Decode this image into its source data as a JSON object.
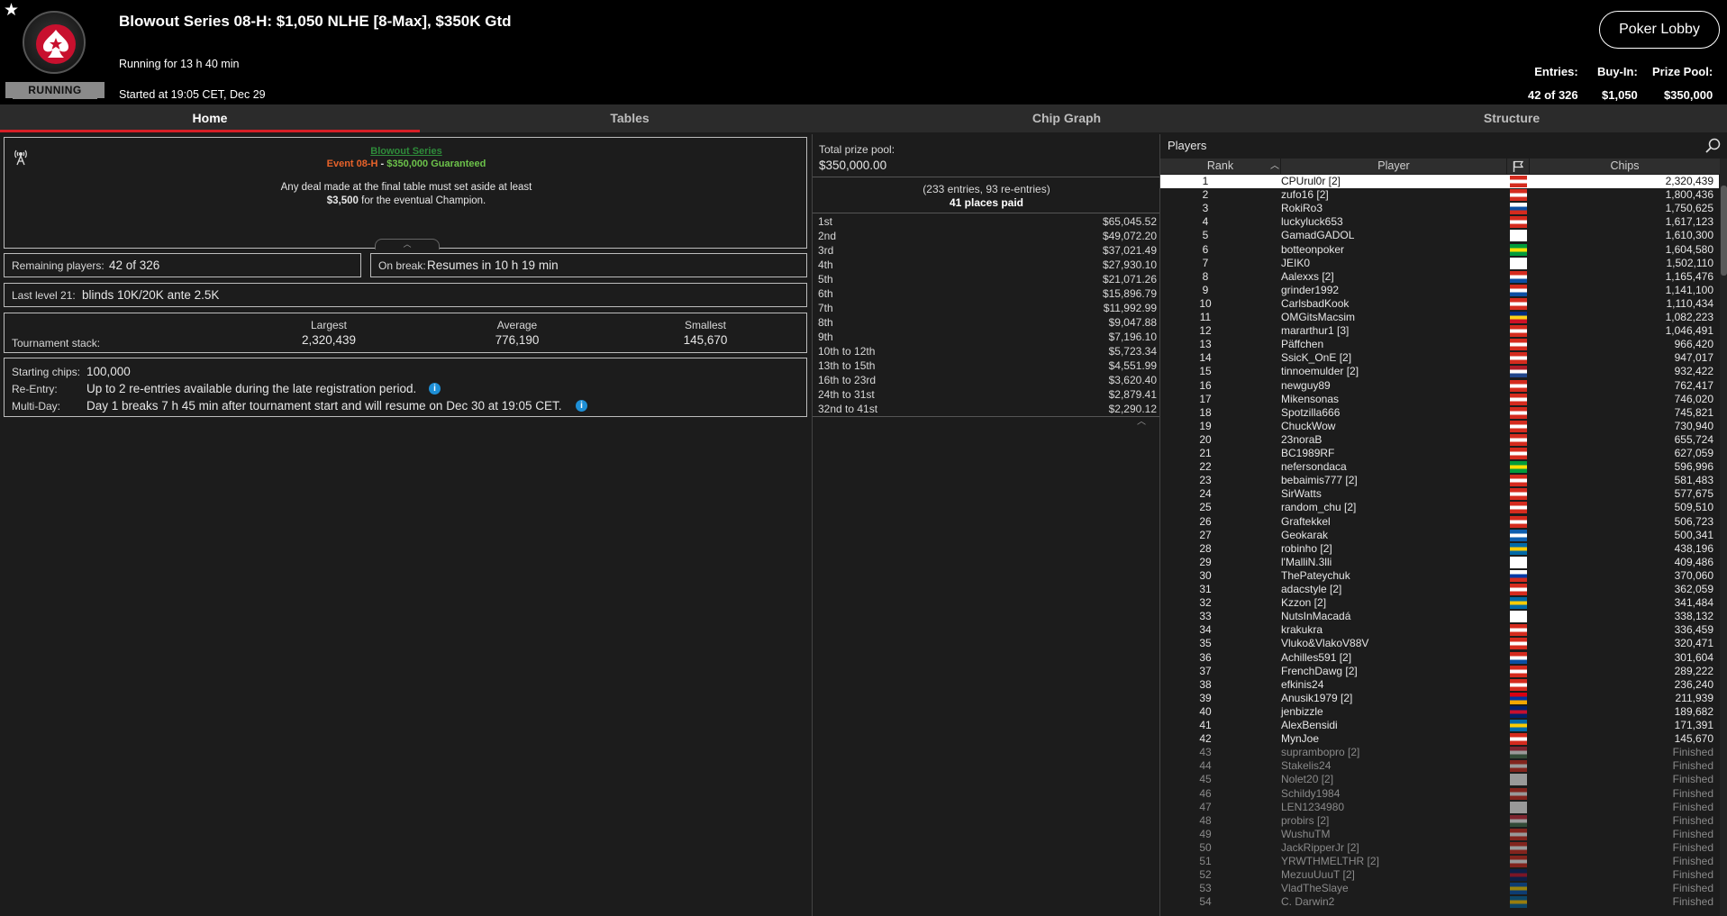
{
  "header": {
    "title": "Blowout Series 08-H: $1,050 NLHE [8-Max], $350K Gtd",
    "running_for": "Running for 13 h 40 min",
    "started": "Started at 19:05 CET, Dec 29",
    "status_badge": "RUNNING",
    "lobby_button": "Poker Lobby",
    "entries_label": "Entries:",
    "entries_value": "42 of 326",
    "buyin_label": "Buy-In:",
    "buyin_value": "$1,050",
    "prizepool_label": "Prize Pool:",
    "prizepool_value": "$350,000"
  },
  "tabs": [
    "Home",
    "Tables",
    "Chip Graph",
    "Structure"
  ],
  "home": {
    "series_link": "Blowout Series",
    "event_name": "Event 08-H",
    "event_sep": " - ",
    "event_guarantee": "$350,000 Guaranteed",
    "deal_note_line1": "Any deal made at the final table must set aside at least",
    "deal_note_amount": "$3,500",
    "deal_note_line2": " for the eventual Champion.",
    "remaining_label": "Remaining players:",
    "remaining_value": "42 of 326",
    "break_label": "On break:",
    "break_value": "Resumes in 10 h 19 min",
    "level_label": "Last level 21:",
    "level_value": "blinds 10K/20K ante 2.5K",
    "stack_label": "Tournament stack:",
    "largest_label": "Largest",
    "largest_value": "2,320,439",
    "average_label": "Average",
    "average_value": "776,190",
    "smallest_label": "Smallest",
    "smallest_value": "145,670",
    "starting_chips_label": "Starting chips:",
    "starting_chips_value": "100,000",
    "reentry_label": "Re-Entry:",
    "reentry_value": "Up to 2 re-entries available during the late registration period.",
    "multiday_label": "Multi-Day:",
    "multiday_value": "Day 1 breaks 7 h 45 min after tournament start and will resume on Dec 30 at 19:05 CET."
  },
  "prizes": {
    "total_label": "Total prize pool:",
    "total_value": "$350,000.00",
    "entries_note": "(233 entries, 93 re-entries)",
    "places_paid": "41 places paid",
    "rows": [
      {
        "place": "1st",
        "amount": "$65,045.52"
      },
      {
        "place": "2nd",
        "amount": "$49,072.20"
      },
      {
        "place": "3rd",
        "amount": "$37,021.49"
      },
      {
        "place": "4th",
        "amount": "$27,930.10"
      },
      {
        "place": "5th",
        "amount": "$21,071.26"
      },
      {
        "place": "6th",
        "amount": "$15,896.79"
      },
      {
        "place": "7th",
        "amount": "$11,992.99"
      },
      {
        "place": "8th",
        "amount": "$9,047.88"
      },
      {
        "place": "9th",
        "amount": "$7,196.10"
      },
      {
        "place": "10th to 12th",
        "amount": "$5,723.34"
      },
      {
        "place": "13th to 15th",
        "amount": "$4,551.99"
      },
      {
        "place": "16th to 23rd",
        "amount": "$3,620.40"
      },
      {
        "place": "24th to 31st",
        "amount": "$2,879.41"
      },
      {
        "place": "32nd to 41st",
        "amount": "$2,290.12"
      }
    ]
  },
  "players": {
    "title": "Players",
    "col_rank": "Rank",
    "col_player": "Player",
    "col_chips": "Chips",
    "rows": [
      {
        "rank": "1",
        "name": "CPUrul0r [2]",
        "chips": "2,320,439",
        "flag": [
          "#d52b1e",
          "#fff",
          "#d52b1e"
        ],
        "selected": true
      },
      {
        "rank": "2",
        "name": "zufo16 [2]",
        "chips": "1,800,436",
        "flag": [
          "#d52b1e",
          "#fff",
          "#d52b1e"
        ]
      },
      {
        "rank": "3",
        "name": "RokiRo3",
        "chips": "1,750,625",
        "flag": [
          "#fff",
          "#0c4ea2",
          "#d52b1e"
        ]
      },
      {
        "rank": "4",
        "name": "luckyluck653",
        "chips": "1,617,123",
        "flag": [
          "#d52b1e",
          "#fff",
          "#d52b1e"
        ]
      },
      {
        "rank": "5",
        "name": "GamadGADOL",
        "chips": "1,610,300",
        "flag": [
          "#fff",
          "#fff",
          "#fff"
        ]
      },
      {
        "rank": "6",
        "name": "botteonpoker",
        "chips": "1,604,580",
        "flag": [
          "#009c3b",
          "#ffdf00",
          "#009c3b"
        ]
      },
      {
        "rank": "7",
        "name": "JEIK0",
        "chips": "1,502,110",
        "flag": [
          "#fff",
          "#fff",
          "#fff"
        ]
      },
      {
        "rank": "8",
        "name": "Aalexxs [2]",
        "chips": "1,165,476",
        "flag": [
          "#d52b1e",
          "#fff",
          "#0c4ea2"
        ]
      },
      {
        "rank": "9",
        "name": "grinder1992",
        "chips": "1,141,100",
        "flag": [
          "#d52b1e",
          "#fff",
          "#0c4ea2"
        ]
      },
      {
        "rank": "10",
        "name": "CarlsbadKook",
        "chips": "1,110,434",
        "flag": [
          "#d52b1e",
          "#fff",
          "#d52b1e"
        ]
      },
      {
        "rank": "11",
        "name": "OMGitsMacsim",
        "chips": "1,082,223",
        "flag": [
          "#002b7f",
          "#fcd116",
          "#ce1126"
        ]
      },
      {
        "rank": "12",
        "name": "mararthur1 [3]",
        "chips": "1,046,491",
        "flag": [
          "#d52b1e",
          "#fff",
          "#d52b1e"
        ]
      },
      {
        "rank": "13",
        "name": "Päffchen",
        "chips": "966,420",
        "flag": [
          "#d52b1e",
          "#fff",
          "#d52b1e"
        ]
      },
      {
        "rank": "14",
        "name": "SsicK_OnE [2]",
        "chips": "947,017",
        "flag": [
          "#d52b1e",
          "#fff",
          "#d52b1e"
        ]
      },
      {
        "rank": "15",
        "name": "tinnoemulder [2]",
        "chips": "932,422",
        "flag": [
          "#ae1c28",
          "#fff",
          "#21468b"
        ]
      },
      {
        "rank": "16",
        "name": "newguy89",
        "chips": "762,417",
        "flag": [
          "#d52b1e",
          "#fff",
          "#d52b1e"
        ]
      },
      {
        "rank": "17",
        "name": "Mikensonas",
        "chips": "746,020",
        "flag": [
          "#d52b1e",
          "#fff",
          "#d52b1e"
        ]
      },
      {
        "rank": "18",
        "name": "Spotzilla666",
        "chips": "745,821",
        "flag": [
          "#d52b1e",
          "#fff",
          "#d52b1e"
        ]
      },
      {
        "rank": "19",
        "name": "ChuckWow",
        "chips": "730,940",
        "flag": [
          "#d52b1e",
          "#fff",
          "#d52b1e"
        ]
      },
      {
        "rank": "20",
        "name": "23noraB",
        "chips": "655,724",
        "flag": [
          "#d52b1e",
          "#fff",
          "#d52b1e"
        ]
      },
      {
        "rank": "21",
        "name": "BC1989RF",
        "chips": "627,059",
        "flag": [
          "#d52b1e",
          "#fff",
          "#d52b1e"
        ]
      },
      {
        "rank": "22",
        "name": "nefersondaca",
        "chips": "596,996",
        "flag": [
          "#009c3b",
          "#ffdf00",
          "#009c3b"
        ]
      },
      {
        "rank": "23",
        "name": "bebaimis777 [2]",
        "chips": "581,483",
        "flag": [
          "#d52b1e",
          "#fff",
          "#d52b1e"
        ]
      },
      {
        "rank": "24",
        "name": "SirWatts",
        "chips": "577,675",
        "flag": [
          "#d52b1e",
          "#fff",
          "#d52b1e"
        ]
      },
      {
        "rank": "25",
        "name": "random_chu [2]",
        "chips": "509,510",
        "flag": [
          "#d52b1e",
          "#fff",
          "#d52b1e"
        ]
      },
      {
        "rank": "26",
        "name": "Graftekkel",
        "chips": "506,723",
        "flag": [
          "#d52b1e",
          "#fff",
          "#d52b1e"
        ]
      },
      {
        "rank": "27",
        "name": "Geokarak",
        "chips": "500,341",
        "flag": [
          "#0d5eaf",
          "#fff",
          "#0d5eaf"
        ]
      },
      {
        "rank": "28",
        "name": "robinho [2]",
        "chips": "438,196",
        "flag": [
          "#006aa7",
          "#fecc00",
          "#006aa7"
        ]
      },
      {
        "rank": "29",
        "name": "l'MalliN.3lli",
        "chips": "409,486",
        "flag": [
          "#fff",
          "#fff",
          "#fff"
        ]
      },
      {
        "rank": "30",
        "name": "ThePateychuk",
        "chips": "370,060",
        "flag": [
          "#fff",
          "#0039a6",
          "#d52b1e"
        ]
      },
      {
        "rank": "31",
        "name": "adacstyle [2]",
        "chips": "362,059",
        "flag": [
          "#d52b1e",
          "#fff",
          "#d52b1e"
        ]
      },
      {
        "rank": "32",
        "name": "Kzzon [2]",
        "chips": "341,484",
        "flag": [
          "#006aa7",
          "#fecc00",
          "#006aa7"
        ]
      },
      {
        "rank": "33",
        "name": "NutsInMacadá",
        "chips": "338,132",
        "flag": [
          "#fff",
          "#fff",
          "#fff"
        ]
      },
      {
        "rank": "34",
        "name": "krakukra",
        "chips": "336,459",
        "flag": [
          "#d52b1e",
          "#fff",
          "#d52b1e"
        ]
      },
      {
        "rank": "35",
        "name": "Vluko&VlakoV88V",
        "chips": "320,471",
        "flag": [
          "#d52b1e",
          "#fff",
          "#d52b1e"
        ]
      },
      {
        "rank": "36",
        "name": "Achilles591 [2]",
        "chips": "301,604",
        "flag": [
          "#d52b1e",
          "#fff",
          "#0c4ea2"
        ]
      },
      {
        "rank": "37",
        "name": "FrenchDawg [2]",
        "chips": "289,222",
        "flag": [
          "#d52b1e",
          "#fff",
          "#d52b1e"
        ]
      },
      {
        "rank": "38",
        "name": "efkinis24",
        "chips": "236,240",
        "flag": [
          "#d52b1e",
          "#fff",
          "#d52b1e"
        ]
      },
      {
        "rank": "39",
        "name": "Anusik1979 [2]",
        "chips": "211,939",
        "flag": [
          "#d90012",
          "#0033a0",
          "#f2a800"
        ]
      },
      {
        "rank": "40",
        "name": "jenbizzle",
        "chips": "189,682",
        "flag": [
          "#012169",
          "#c8102e",
          "#012169"
        ]
      },
      {
        "rank": "41",
        "name": "AlexBensidi",
        "chips": "171,391",
        "flag": [
          "#006aa7",
          "#fecc00",
          "#006aa7"
        ]
      },
      {
        "rank": "42",
        "name": "MynJoe",
        "chips": "145,670",
        "flag": [
          "#d52b1e",
          "#fff",
          "#d52b1e"
        ]
      },
      {
        "rank": "43",
        "name": "suprambopro [2]",
        "chips": "Finished",
        "flag": [
          "#cd2a3e",
          "#fff",
          "#436f4d"
        ]
      },
      {
        "rank": "44",
        "name": "Stakelis24",
        "chips": "Finished",
        "flag": [
          "#d52b1e",
          "#fff",
          "#d52b1e"
        ]
      },
      {
        "rank": "45",
        "name": "Nolet20 [2]",
        "chips": "Finished",
        "flag": [
          "#fff",
          "#fff",
          "#fff"
        ]
      },
      {
        "rank": "46",
        "name": "Schildy1984",
        "chips": "Finished",
        "flag": [
          "#d52b1e",
          "#fff",
          "#d52b1e"
        ]
      },
      {
        "rank": "47",
        "name": "LEN1234980",
        "chips": "Finished",
        "flag": [
          "#fff",
          "#fff",
          "#fff"
        ]
      },
      {
        "rank": "48",
        "name": "probirs [2]",
        "chips": "Finished",
        "flag": [
          "#cd2a3e",
          "#fff",
          "#436f4d"
        ]
      },
      {
        "rank": "49",
        "name": "WushuTM",
        "chips": "Finished",
        "flag": [
          "#d52b1e",
          "#fff",
          "#d52b1e"
        ]
      },
      {
        "rank": "50",
        "name": "JackRipperJr [2]",
        "chips": "Finished",
        "flag": [
          "#d52b1e",
          "#fff",
          "#d52b1e"
        ]
      },
      {
        "rank": "51",
        "name": "YRWTHMELTHR [2]",
        "chips": "Finished",
        "flag": [
          "#d52b1e",
          "#fff",
          "#d52b1e"
        ]
      },
      {
        "rank": "52",
        "name": "MezuuUuuT [2]",
        "chips": "Finished",
        "flag": [
          "#012169",
          "#c8102e",
          "#012169"
        ]
      },
      {
        "rank": "53",
        "name": "VladTheSlaye",
        "chips": "Finished",
        "flag": [
          "#0057b7",
          "#ffd700",
          "#0057b7"
        ]
      },
      {
        "rank": "54",
        "name": "C. Darwin2",
        "chips": "Finished",
        "flag": [
          "#006aa7",
          "#fecc00",
          "#006aa7"
        ]
      }
    ]
  },
  "colors": {
    "accent_red": "#d71f26",
    "series_link": "#2e8b3a",
    "event_orange": "#e8622a",
    "guarantee_green": "#6cc24a",
    "info_blue": "#1e8fd6"
  }
}
